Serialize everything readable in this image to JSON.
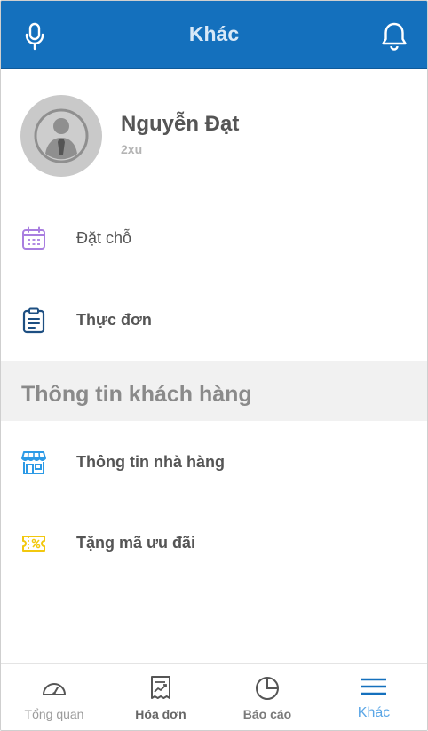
{
  "header": {
    "title": "Khác",
    "mic_icon": "microphone-icon",
    "bell_icon": "bell-icon",
    "background_color": "#1470bd"
  },
  "profile": {
    "name": "Nguyễn Đạt",
    "subtitle": "2xu",
    "avatar_icon": "user-avatar-icon"
  },
  "menu": {
    "items": [
      {
        "label": "Đặt chỗ",
        "icon": "calendar-icon",
        "icon_color": "#a97ee0"
      },
      {
        "label": "Thực đơn",
        "icon": "clipboard-icon",
        "icon_color": "#1d4f82"
      }
    ]
  },
  "section": {
    "title": "Thông tin khách hàng",
    "items": [
      {
        "label": "Thông tin nhà hàng",
        "icon": "store-icon",
        "icon_color": "#2c9ae6"
      },
      {
        "label": "Tặng mã ưu đãi",
        "icon": "coupon-icon",
        "icon_color": "#f2c80f"
      }
    ]
  },
  "bottom_nav": {
    "items": [
      {
        "label": "Tổng quan",
        "icon": "dashboard-gauge-icon",
        "active": false
      },
      {
        "label": "Hóa đơn",
        "icon": "receipt-icon",
        "active": false
      },
      {
        "label": "Báo cáo",
        "icon": "pie-chart-icon",
        "active": false
      },
      {
        "label": "Khác",
        "icon": "menu-icon",
        "active": true
      }
    ],
    "active_color": "#5aa6e6"
  }
}
